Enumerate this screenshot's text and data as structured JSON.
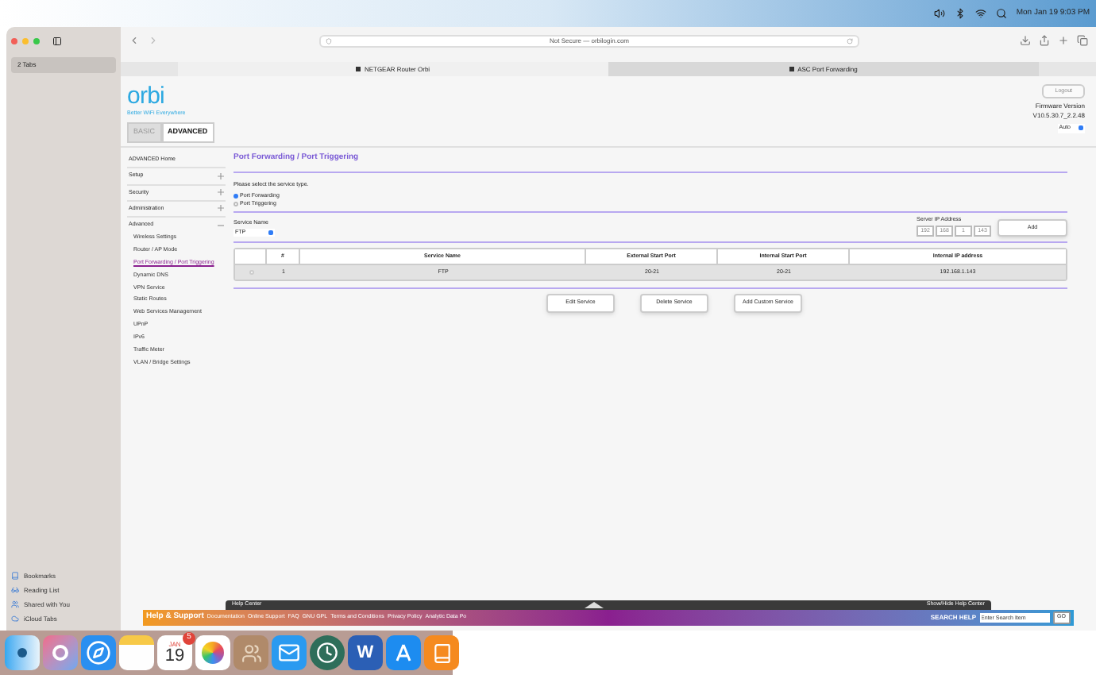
{
  "menubar": {
    "clock": "Mon Jan 19  9:03 PM"
  },
  "sidebar": {
    "tab_group": "2 Tabs",
    "items": [
      {
        "kind": "bookmarks",
        "label": "Bookmarks"
      },
      {
        "kind": "reading",
        "label": "Reading List"
      },
      {
        "kind": "shared",
        "label": "Shared with You"
      },
      {
        "kind": "cloud",
        "label": "iCloud Tabs"
      }
    ]
  },
  "address_bar": {
    "text": "Not Secure — orbilogin.com"
  },
  "tabs": [
    {
      "label": "NETGEAR Router Orbi",
      "selected": false
    },
    {
      "label": "ASC Port Forwarding",
      "selected": true
    }
  ],
  "header": {
    "logo": "orbi",
    "tagline": "Better WiFi Everywhere",
    "mode_tabs": [
      {
        "label": "BASIC",
        "selected": false
      },
      {
        "label": "ADVANCED",
        "selected": true
      }
    ],
    "logout": "Logout",
    "firmware_label": "Firmware Version",
    "firmware": "V10.5.30.7_2.2.48",
    "language": "Auto"
  },
  "nav": {
    "home": "ADVANCED Home",
    "sections": [
      {
        "label": "Setup",
        "expanded": false
      },
      {
        "label": "Security",
        "expanded": false
      },
      {
        "label": "Administration",
        "expanded": false
      },
      {
        "label": "Advanced",
        "expanded": true,
        "children": [
          {
            "label": "Wireless Settings",
            "selected": false
          },
          {
            "label": "Router / AP Mode",
            "selected": false
          },
          {
            "label": "Port Forwarding / Port Triggering",
            "selected": true
          },
          {
            "label": "Dynamic DNS",
            "selected": false
          },
          {
            "label": "VPN Service",
            "selected": false
          },
          {
            "label": "Static Routes",
            "selected": false
          },
          {
            "label": "Web Services Management",
            "selected": false
          },
          {
            "label": "UPnP",
            "selected": false
          },
          {
            "label": "IPv6",
            "selected": false
          },
          {
            "label": "Traffic Meter",
            "selected": false
          },
          {
            "label": "VLAN / Bridge Settings",
            "selected": false
          }
        ]
      }
    ]
  },
  "main": {
    "title": "Port Forwarding / Port Triggering",
    "prompt": "Please select the service type.",
    "service_types": [
      {
        "label": "Port Forwarding",
        "selected": true
      },
      {
        "label": "Port Triggering",
        "selected": false
      }
    ],
    "service_name_label": "Service Name",
    "service_name": "FTP",
    "server_ip_label": "Server IP Address",
    "server_ip": [
      "192",
      "168",
      "1",
      "143"
    ],
    "add": "Add",
    "table": {
      "columns": [
        "#",
        "Service Name",
        "External Start Port",
        "Internal Start Port",
        "Internal IP address"
      ],
      "rows": [
        {
          "selected": false,
          "cells": [
            "1",
            "FTP",
            "20-21",
            "20-21",
            "192.168.1.143"
          ]
        }
      ]
    },
    "buttons": [
      "Edit Service",
      "Delete Service",
      "Add Custom Service"
    ]
  },
  "help_center": {
    "left": "Help Center",
    "right": "Show/Hide Help Center"
  },
  "help_bar": {
    "title": "Help & Support",
    "links": [
      "Documentation",
      "Online Support",
      "FAQ",
      "GNU GPL",
      "Terms and Conditions",
      "Privacy Policy",
      "Analytic Data Po"
    ],
    "search_label": "SEARCH HELP",
    "search_placeholder": "Enter Search Item",
    "go": "GO"
  },
  "dock": [
    {
      "kind": "finder"
    },
    {
      "kind": "launchpad"
    },
    {
      "kind": "safari"
    },
    {
      "kind": "notes"
    },
    {
      "kind": "calendar",
      "month": "JAN",
      "day": "19",
      "badge": "5"
    },
    {
      "kind": "photos"
    },
    {
      "kind": "contacts"
    },
    {
      "kind": "mail"
    },
    {
      "kind": "timemachine"
    },
    {
      "kind": "word",
      "letter": "W"
    },
    {
      "kind": "appstore"
    },
    {
      "kind": "books"
    }
  ]
}
